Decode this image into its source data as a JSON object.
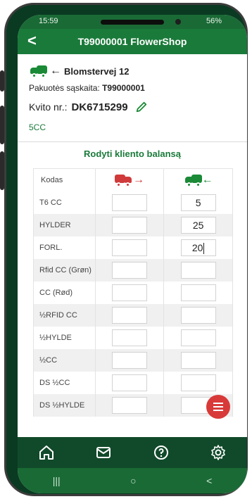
{
  "status": {
    "time": "15:59",
    "battery": "56%"
  },
  "header": {
    "back_label": "<",
    "title": "T99000001 FlowerShop"
  },
  "info": {
    "address": "Blomstervej 12",
    "account_label": "Pakuotės sąskaita:",
    "account_value": "T99000001",
    "receipt_label": "Kvito nr.:",
    "receipt_value": "DK6715299",
    "cc": "5CC"
  },
  "balance_link": "Rodyti kliento balansą",
  "table": {
    "header_code": "Kodas",
    "rows": [
      {
        "code": "T6 CC",
        "out": "",
        "in": "5"
      },
      {
        "code": "HYLDER",
        "out": "",
        "in": "25"
      },
      {
        "code": "FORL.",
        "out": "",
        "in": "20"
      },
      {
        "code": "Rfid CC (Grøn)",
        "out": "",
        "in": ""
      },
      {
        "code": "CC (Rød)",
        "out": "",
        "in": ""
      },
      {
        "code": "½RFID CC",
        "out": "",
        "in": ""
      },
      {
        "code": "½HYLDE",
        "out": "",
        "in": ""
      },
      {
        "code": "½CC",
        "out": "",
        "in": ""
      },
      {
        "code": "DS ½CC",
        "out": "",
        "in": ""
      },
      {
        "code": "DS ½HYLDE",
        "out": "",
        "in": ""
      }
    ]
  },
  "sysnav": {
    "recents": "|||",
    "home": "○",
    "back": "<"
  },
  "colors": {
    "primary": "#1a7a3a",
    "accent": "#d83a3a",
    "nav_bg": "#114a2a"
  }
}
